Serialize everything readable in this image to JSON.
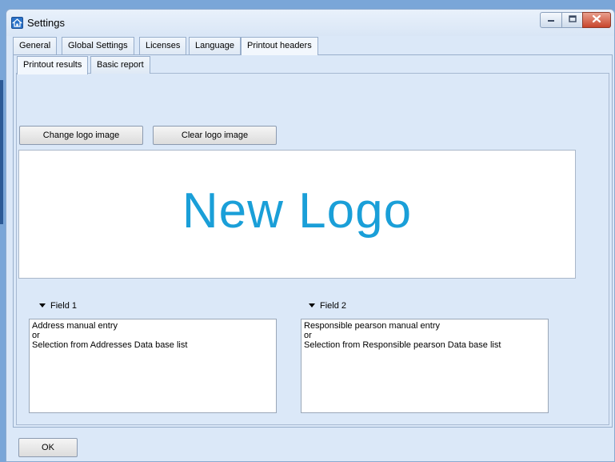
{
  "window": {
    "title": "Settings"
  },
  "tabs_main": [
    "General",
    "Global Settings",
    "Licenses",
    "Language",
    "Printout headers"
  ],
  "tabs_sub": [
    "Printout results",
    "Basic report"
  ],
  "buttons": {
    "change_logo": "Change logo image",
    "clear_logo": "Clear logo image",
    "ok": "OK"
  },
  "logo": {
    "text": "New Logo",
    "color": "#1a9fd8"
  },
  "field1": {
    "label": "Field 1",
    "lines": [
      "Address manual entry",
      "or",
      "Selection from Addresses Data base list"
    ]
  },
  "field2": {
    "label": "Field 2",
    "lines": [
      "Responsible pearson manual entry",
      "or",
      "Selection from Responsible pearson Data base list"
    ]
  },
  "icons": {
    "app": "home-icon",
    "minimize": "minimize-icon",
    "maximize": "maximize-icon",
    "close": "close-icon",
    "collapse": "triangle-down-icon"
  }
}
